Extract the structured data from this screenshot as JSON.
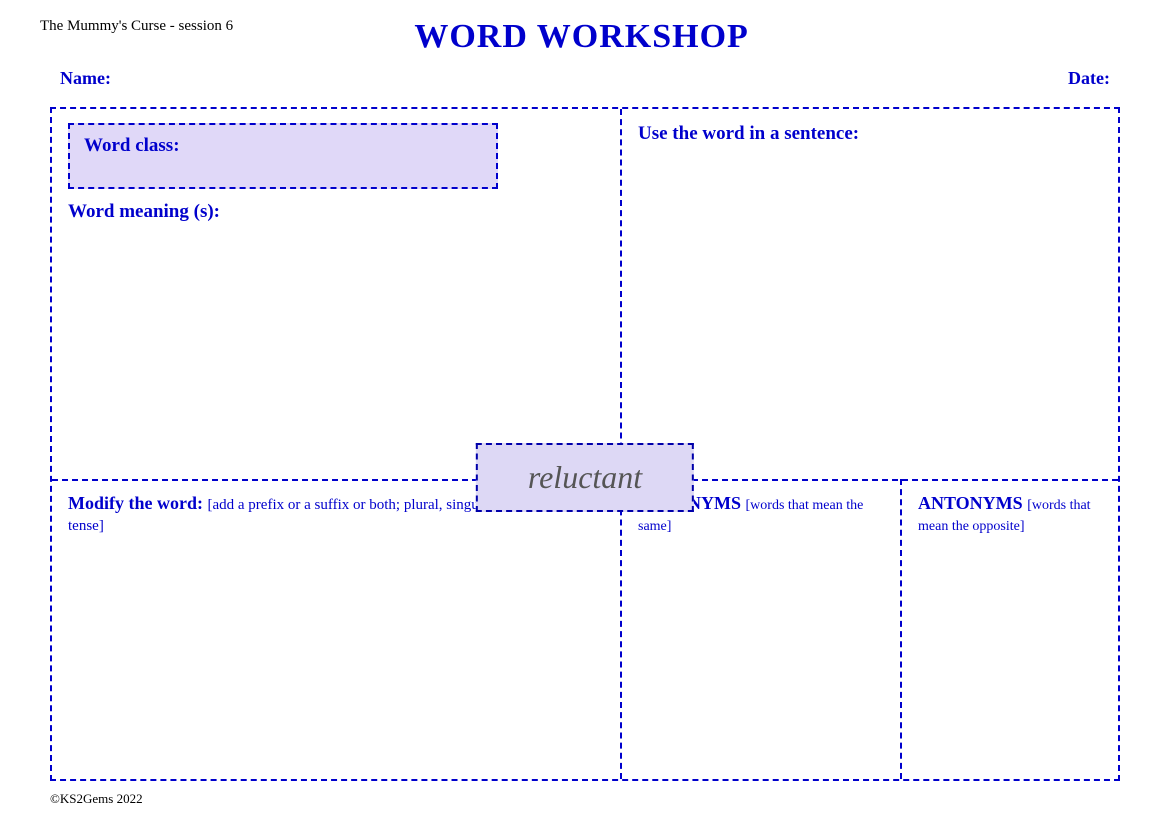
{
  "header": {
    "subtitle": "The Mummy's Curse - session 6",
    "title": "WORD WORKSHOP"
  },
  "nameDate": {
    "nameLabel": "Name:",
    "dateLabel": "Date:"
  },
  "leftPanel": {
    "wordClassLabel": "Word class:",
    "wordMeaningLabel": "Word meaning (s):"
  },
  "rightPanel": {
    "useSentenceLabel": "Use the word in a sentence:"
  },
  "centerWord": {
    "word": "reluctant"
  },
  "bottomPanels": {
    "modifyLabel": "Modify the word:",
    "modifyBracket": "[add a prefix or a suffix or both; plural, singular; change the verb tense]",
    "synonymsLabel": "SYNONYMS",
    "synonymsBracket": "[words that mean the same]",
    "antonymsLabel": "ANTONYMS",
    "antonymsBracket": "[words that mean the opposite]"
  },
  "footer": {
    "copyright": "©KS2Gems 2022"
  }
}
